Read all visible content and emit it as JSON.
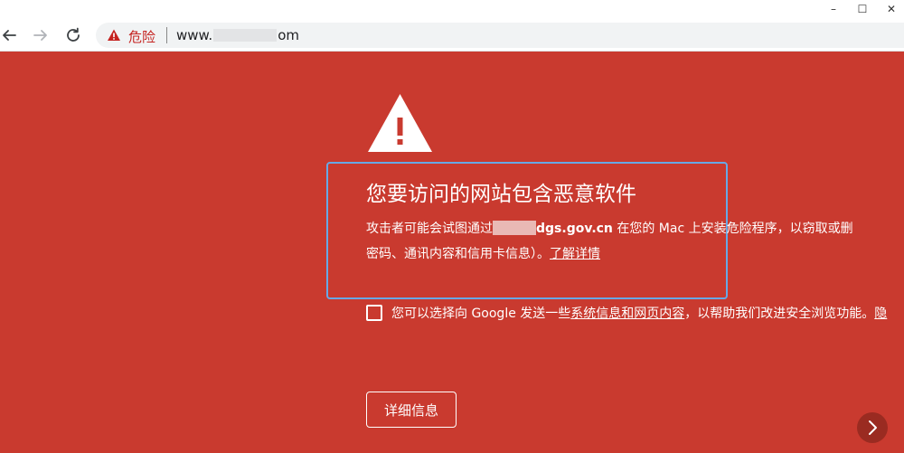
{
  "window": {
    "minimize_glyph": "–",
    "maximize_glyph": "☐",
    "close_glyph": "✕"
  },
  "toolbar": {
    "back_icon": "back-arrow-icon",
    "forward_icon": "forward-arrow-icon",
    "reload_icon": "reload-icon"
  },
  "omnibox": {
    "security_label": "危险",
    "url_prefix": "www.",
    "url_suffix": "om"
  },
  "interstitial": {
    "heading": "您要访问的网站包含恶意软件",
    "desc_line1_before": "攻击者可能会试图通过",
    "desc_domain": "dgs.gov.cn",
    "desc_line1_after": " 在您的 Mac 上安装危险程序，以窃取或删",
    "desc_line2": "密码、通讯内容和信用卡信息）。",
    "learn_more": "了解详情",
    "optin_before": "您可以选择向 Google 发送一些",
    "optin_link": "系统信息和网页内容",
    "optin_after": "，以帮助我们改进安全浏览功能。",
    "optin_trailing": "隐",
    "details_button": "详细信息"
  },
  "colors": {
    "page_bg": "#c93a2f",
    "danger_red": "#c5221f",
    "focus_ring": "#67a8e6"
  }
}
